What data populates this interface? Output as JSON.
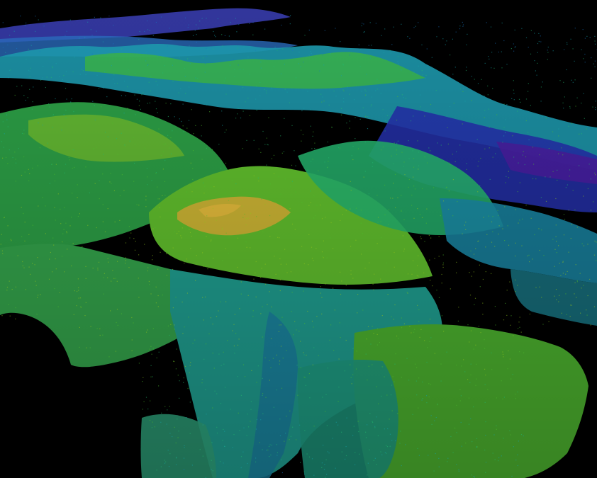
{
  "scene": {
    "background_color": "#000000",
    "colormap": [
      "#3a0a8c",
      "#2a3fb8",
      "#1a74c2",
      "#16a3a8",
      "#23b86e",
      "#4cbb2c",
      "#8fc21e",
      "#d2b530"
    ],
    "render_style": "point-cloud-terrain",
    "view": "oblique-perspective"
  }
}
